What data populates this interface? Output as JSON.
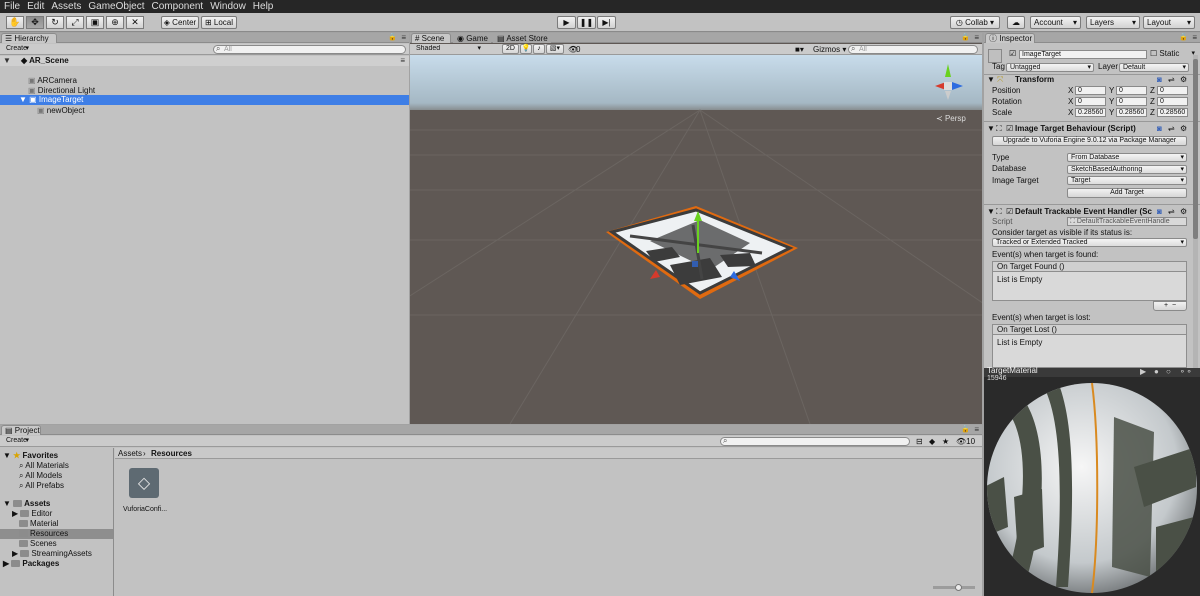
{
  "menu": [
    "File",
    "Edit",
    "Assets",
    "GameObject",
    "Component",
    "Window",
    "Help"
  ],
  "toolbar": {
    "tools": [
      "hand-icon",
      "move-icon",
      "rotate-icon",
      "scale-icon",
      "rect-icon",
      "transform-icon",
      "custom-tool-icon"
    ],
    "pivot_label": "Center",
    "space_label": "Local",
    "play_icons": [
      "play-icon",
      "pause-icon",
      "step-icon"
    ],
    "collab_label": "Collab",
    "account_label": "Account",
    "layers_label": "Layers",
    "layout_label": "Layout"
  },
  "hierarchy": {
    "tab": "Hierarchy",
    "create_label": "Create",
    "search_placeholder": "All",
    "scene": "AR_Scene",
    "items": [
      {
        "label": "ARCamera",
        "depth": 1
      },
      {
        "label": "Directional Light",
        "depth": 1
      },
      {
        "label": "ImageTarget",
        "depth": 1,
        "selected": true
      },
      {
        "label": "newObject",
        "depth": 2
      }
    ]
  },
  "scene_view": {
    "tabs": [
      "Scene",
      "Game",
      "Asset Store"
    ],
    "shading": "Shaded",
    "mode_2d": "2D",
    "effects_count": "0",
    "gizmos_label": "Gizmos",
    "search_placeholder": "All",
    "persp_label": "Persp"
  },
  "inspector": {
    "tab": "Inspector",
    "object_name": "ImageTarget",
    "static_label": "Static",
    "tag_label": "Tag",
    "tag_value": "Untagged",
    "layer_label": "Layer",
    "layer_value": "Default",
    "transform": {
      "title": "Transform",
      "position_label": "Position",
      "rotation_label": "Rotation",
      "scale_label": "Scale",
      "position": [
        "0",
        "0",
        "0"
      ],
      "rotation": [
        "0",
        "0",
        "0"
      ],
      "scale": [
        "0.28560",
        "0.28560",
        "0.28560"
      ]
    },
    "image_target": {
      "title": "Image Target Behaviour (Script)",
      "upgrade_button": "Upgrade to Vuforia Engine 9.0.12 via Package Manager",
      "type_label": "Type",
      "type_value": "From Database",
      "database_label": "Database",
      "database_value": "SketchBasedAuthoring",
      "target_label": "Image Target",
      "target_value": "Target",
      "add_target_button": "Add Target"
    },
    "event_handler": {
      "title": "Default Trackable Event Handler (Sc",
      "script_label": "Script",
      "script_value": "DefaultTrackableEventHandle",
      "consider_label": "Consider target as visible if its status is:",
      "status_value": "Tracked or Extended Tracked",
      "found_label": "Event(s) when target is found:",
      "found_header": "On Target Found ()",
      "found_list": "List is Empty",
      "lost_label": "Event(s) when target is lost:",
      "lost_header": "On Target Lost ()",
      "lost_list": "List is Empty"
    }
  },
  "preview": {
    "title": "TargetMaterial",
    "subtitle": "15946"
  },
  "project": {
    "tab": "Project",
    "create_label": "Create",
    "count": "10",
    "favorites_label": "Favorites",
    "favorites": [
      "All Materials",
      "All Models",
      "All Prefabs"
    ],
    "assets_label": "Assets",
    "assets_children": [
      "Editor",
      "Material",
      "Resources",
      "Scenes",
      "StreamingAssets"
    ],
    "packages_label": "Packages",
    "breadcrumb": [
      "Assets",
      "Resources"
    ],
    "files": [
      "VuforiaConfi..."
    ]
  }
}
